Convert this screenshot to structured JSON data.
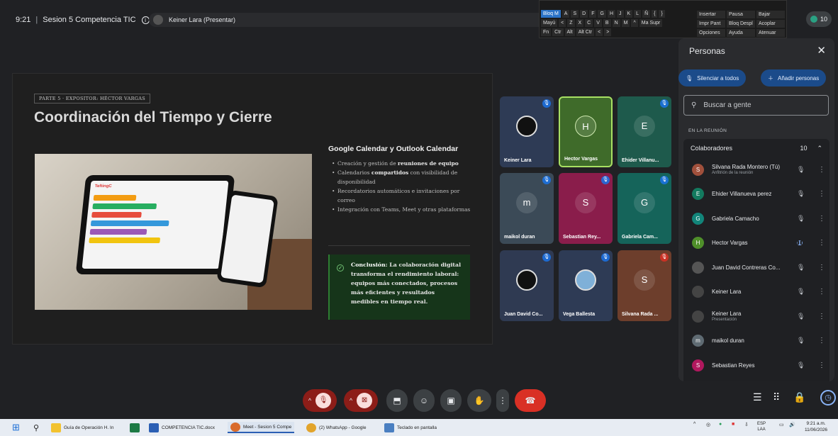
{
  "topbar": {
    "time": "9:21",
    "meeting_title": "Sesion 5 Competencia TIC",
    "presenting_label": "Keiner Lara (Presentar)",
    "people_count": "10"
  },
  "keyboard": {
    "row1": [
      "Bloq M",
      "A",
      "S",
      "D",
      "F",
      "G",
      "H",
      "J",
      "K",
      "L",
      "Ñ",
      "{",
      "}"
    ],
    "row2": [
      "Mayú",
      "<",
      "Z",
      "X",
      "C",
      "V",
      "B",
      "N",
      "M",
      "^",
      "Ma Supr"
    ],
    "row3": [
      "Fn",
      "Ctr",
      "Alt",
      "Alt Ctr",
      "<",
      ">"
    ],
    "right": [
      "Insertar",
      "Pausa",
      "Bajar",
      "Impr Pant",
      "Bloq Despl",
      "Acoplar",
      "Opciones",
      "Ayuda",
      "Atenuar"
    ]
  },
  "slide": {
    "tag": "PARTE 5 · EXPOSITOR: HÉCTOR VARGAS",
    "title": "Coordinación del Tiempo y Cierre",
    "section_title": "Google Calendar y Outlook Calendar",
    "bullets": [
      {
        "pre": "Creación y gestión de ",
        "bold": "reuniones de equipo",
        "post": ""
      },
      {
        "pre": "Calendarios ",
        "bold": "compartidos",
        "post": " con visibilidad de disponibilidad"
      },
      {
        "pre": "Recordatorios automáticos e invitaciones por correo",
        "bold": "",
        "post": ""
      },
      {
        "pre": "Integración con Teams, Meet y otras plataformas",
        "bold": "",
        "post": ""
      }
    ],
    "conclusion_lead": "Conclusión:",
    "conclusion_text": " La colaboración digital transforma el rendimiento laboral: equipos más conectados, procesos más eficientes y resultados medibles en tiempo real.",
    "app_label": "TeftingC"
  },
  "tiles": [
    {
      "name": "Keiner Lara",
      "initial": "",
      "color": "#2e3b55"
    },
    {
      "name": "Hector Vargas",
      "initial": "H",
      "color": "#3f6b2a"
    },
    {
      "name": "Ehider Villanu...",
      "initial": "E",
      "color": "#1e5a4c"
    },
    {
      "name": "maikol duran",
      "initial": "m",
      "color": "#3b4a57"
    },
    {
      "name": "Sebastian Rey...",
      "initial": "S",
      "color": "#8a1d4b"
    },
    {
      "name": "Gabriela Cam...",
      "initial": "G",
      "color": "#15645a"
    },
    {
      "name": "Juan David Co...",
      "initial": "",
      "color": "#2f3a52"
    },
    {
      "name": "Vega Ballesta",
      "initial": "",
      "color": "#2e3b55"
    },
    {
      "name": "Silvana Rada ...",
      "initial": "S",
      "color": "#6d3e2c"
    }
  ],
  "panel": {
    "title": "Personas",
    "mute_all": "Silenciar a todos",
    "add_people": "Añadir personas",
    "search_placeholder": "Buscar a gente",
    "in_meeting": "EN LA REUNIÓN",
    "group": "Colaboradores",
    "group_count": "10",
    "people": [
      {
        "name": "Silvana Rada Montero (Tú)",
        "sub": "Anfitrión de la reunión",
        "initial": "S",
        "color": "#a0503c"
      },
      {
        "name": "Ehider Villanueva perez",
        "sub": "",
        "initial": "E",
        "color": "#137a5f"
      },
      {
        "name": "Gabriela Camacho",
        "sub": "",
        "initial": "G",
        "color": "#12857a"
      },
      {
        "name": "Hector Vargas",
        "sub": "",
        "initial": "H",
        "color": "#4f8f2a"
      },
      {
        "name": "Juan David Contreras Co...",
        "sub": "",
        "initial": "",
        "color": "#555"
      },
      {
        "name": "Keiner Lara",
        "sub": "",
        "initial": "",
        "color": "#444"
      },
      {
        "name": "Keiner Lara",
        "sub": "Presentación",
        "initial": "",
        "color": "#444"
      },
      {
        "name": "maikol duran",
        "sub": "",
        "initial": "m",
        "color": "#5f6b73"
      },
      {
        "name": "Sebastian Reyes",
        "sub": "",
        "initial": "S",
        "color": "#b0185e"
      }
    ]
  },
  "taskbar": {
    "items": [
      "Guía de Operación H. In",
      "",
      "COMPETENCIA TIC.docx",
      "Meet - Sesion 5 Compe",
      "(2) WhatsApp - Google",
      "Teclado en pantalla"
    ],
    "lang": "ESP",
    "lang2": "LAA",
    "clock_time": "9:21 a.m.",
    "clock_date": "11/06/2026"
  }
}
